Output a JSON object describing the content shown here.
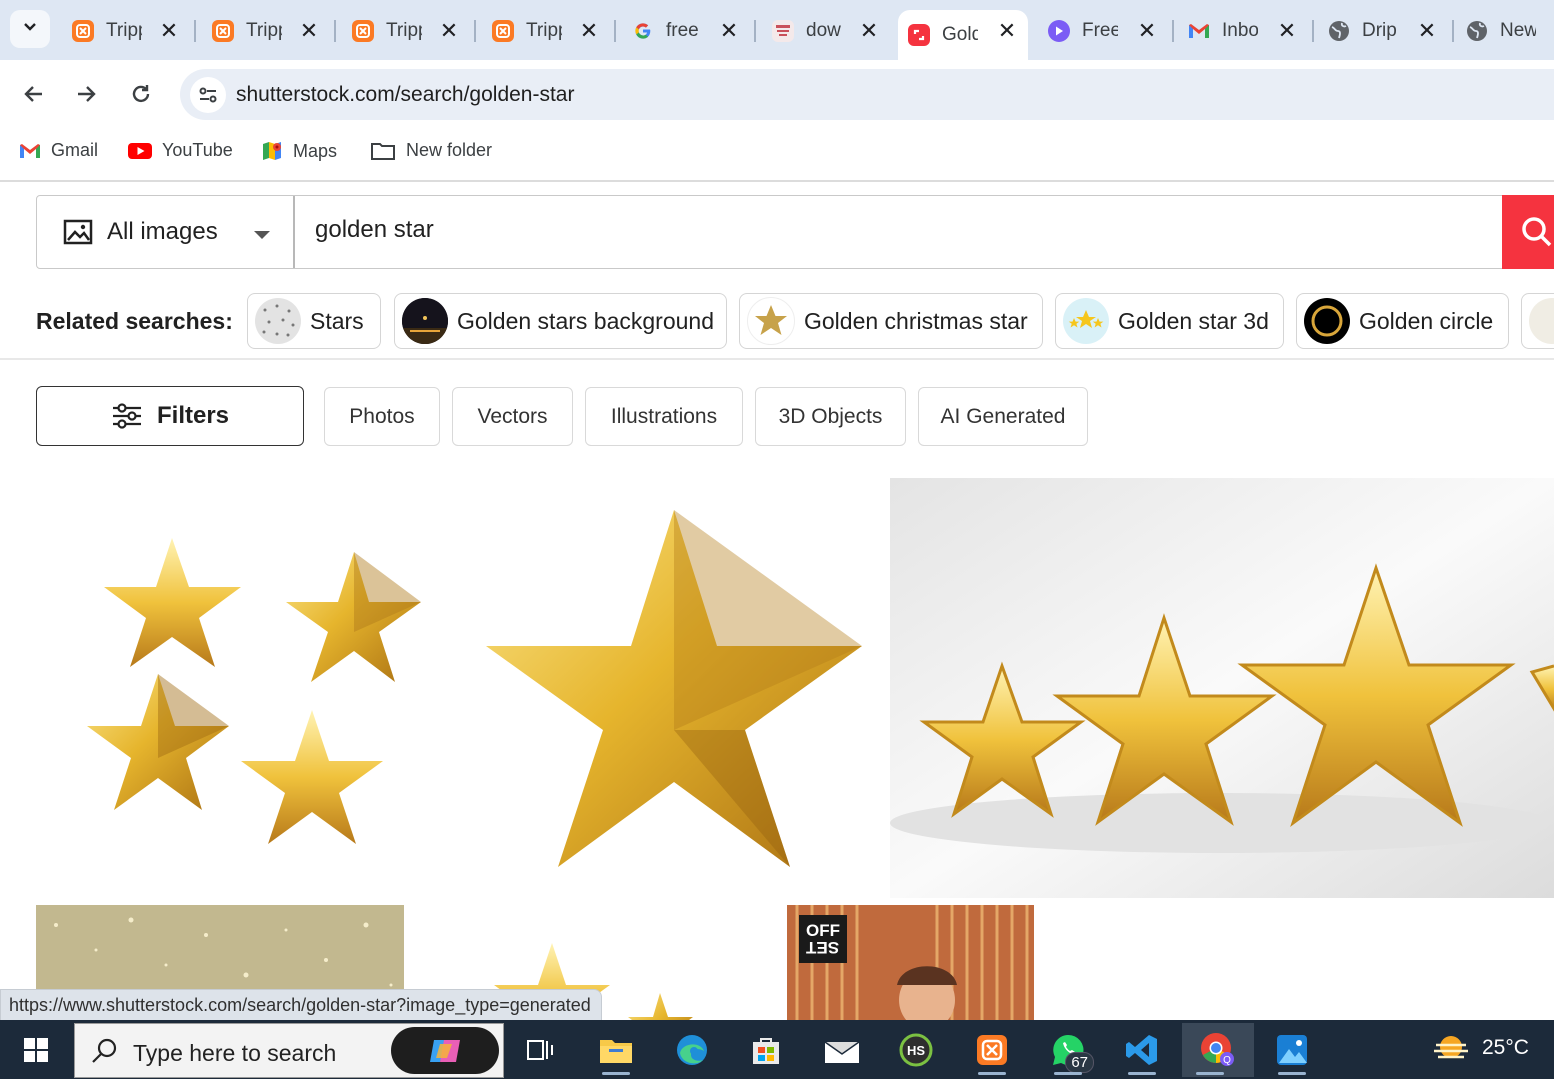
{
  "browser": {
    "tabs": [
      {
        "title": "Tripp",
        "icon": "xampp-icon",
        "color": "#fb7a24"
      },
      {
        "title": "Tripp",
        "icon": "xampp-icon",
        "color": "#fb7a24"
      },
      {
        "title": "Tripp",
        "icon": "xampp-icon",
        "color": "#fb7a24"
      },
      {
        "title": "Tripp",
        "icon": "xampp-icon",
        "color": "#fb7a24"
      },
      {
        "title": "free",
        "icon": "google-icon",
        "color": "#4285f4"
      },
      {
        "title": "dow",
        "icon": "discover-icon",
        "color": "#c9505a"
      },
      {
        "title": "Golden",
        "icon": "shutterstock-icon",
        "color": "#f5333f",
        "active": true
      },
      {
        "title": "Free",
        "icon": "play-icon",
        "color": "#7b5cf5"
      },
      {
        "title": "Inbox",
        "icon": "gmail-icon",
        "color": "#ea4335"
      },
      {
        "title": "Drip",
        "icon": "globe-icon",
        "color": "#5f6368"
      },
      {
        "title": "New",
        "icon": "globe-icon",
        "color": "#5f6368"
      }
    ],
    "address": "shutterstock.com/search/golden-star",
    "bookmarks": [
      {
        "label": "Gmail",
        "icon": "gmail-icon"
      },
      {
        "label": "YouTube",
        "icon": "youtube-icon"
      },
      {
        "label": "Maps",
        "icon": "maps-icon"
      },
      {
        "label": "New folder",
        "icon": "folder-icon"
      }
    ],
    "status_url": "https://www.shutterstock.com/search/golden-star?image_type=generated"
  },
  "search": {
    "type_label": "All images",
    "query": "golden star"
  },
  "related": {
    "title": "Related searches:",
    "items": [
      "Stars",
      "Golden stars background",
      "Golden christmas star",
      "Golden star 3d",
      "Golden circle"
    ]
  },
  "filters": {
    "button_label": "Filters",
    "tabs": [
      "Photos",
      "Vectors",
      "Illustrations",
      "3D Objects",
      "AI Generated"
    ]
  },
  "results": {
    "offset_badge": [
      "OFF",
      "SET"
    ]
  },
  "taskbar": {
    "search_placeholder": "Type here to search",
    "whatsapp_badge": "67",
    "temperature": "25°C"
  },
  "colors": {
    "accent": "#f5333f",
    "gold": "#e8b62c"
  }
}
